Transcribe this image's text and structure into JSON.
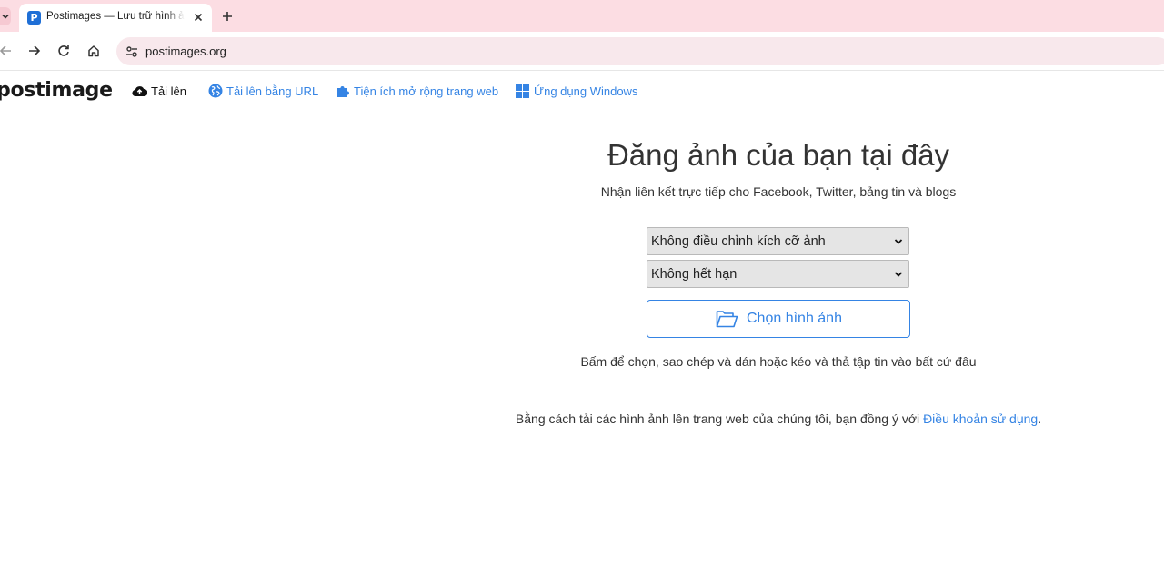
{
  "browser": {
    "tab_title": "Postimages — Lưu trữ hình ảnh",
    "tab_favicon_letter": "P",
    "url": "postimages.org"
  },
  "site": {
    "logo": "postimage",
    "nav": {
      "upload": "Tải lên",
      "upload_url": "Tải lên bằng URL",
      "extension": "Tiện ích mở rộng trang web",
      "windows_app": "Ứng dụng Windows"
    }
  },
  "main": {
    "headline": "Đăng ảnh của bạn tại đây",
    "subline": "Nhận liên kết trực tiếp cho Facebook, Twitter, bảng tin và blogs",
    "resize_select": "Không điều chỉnh kích cỡ ảnh",
    "expire_select": "Không hết hạn",
    "choose_button": "Chọn hình ảnh",
    "hint": "Bấm để chọn, sao chép và dán hoặc kéo và thả tập tin vào bất cứ đâu",
    "terms_prefix": "Bằng cách tải các hình ảnh lên trang web của chúng tôi, bạn đồng ý với ",
    "terms_link": "Điều khoản sử dụng",
    "terms_suffix": "."
  },
  "icons": {
    "tab_menu": "chevron-down-icon",
    "favicon": "postimages-favicon-icon",
    "tab_close": "close-icon",
    "new_tab": "plus-icon",
    "back": "arrow-left-icon",
    "forward": "arrow-right-icon",
    "reload": "reload-icon",
    "home": "home-icon",
    "site_info": "tune-icon",
    "upload": "cloud-upload-icon",
    "upload_url": "globe-icon",
    "extension": "puzzle-icon",
    "windows": "windows-icon",
    "folder": "folder-open-icon"
  },
  "colors": {
    "tabstrip": "#fcdde3",
    "omnibox": "#f8e8ec",
    "link_blue": "#3584e4",
    "select_bg": "#e5e5e5"
  }
}
